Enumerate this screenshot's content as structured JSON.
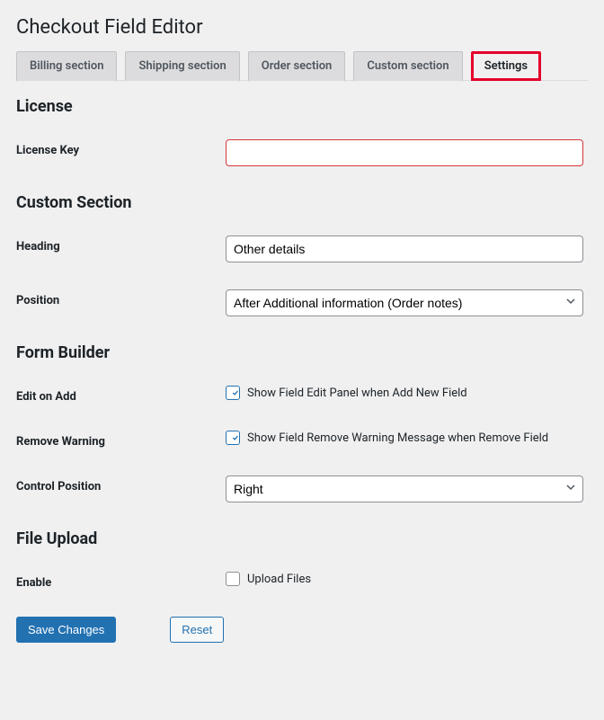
{
  "page_title": "Checkout Field Editor",
  "tabs": {
    "billing": "Billing section",
    "shipping": "Shipping section",
    "order": "Order section",
    "custom": "Custom section",
    "settings": "Settings"
  },
  "sections": {
    "license": {
      "heading": "License",
      "license_key_label": "License Key",
      "license_key_value": ""
    },
    "custom_section": {
      "heading": "Custom Section",
      "heading_label": "Heading",
      "heading_value": "Other details",
      "position_label": "Position",
      "position_value": "After Additional information (Order notes)"
    },
    "form_builder": {
      "heading": "Form Builder",
      "edit_on_add_label": "Edit on Add",
      "edit_on_add_text": "Show Field Edit Panel when Add New Field",
      "edit_on_add_checked": true,
      "remove_warning_label": "Remove Warning",
      "remove_warning_text": "Show Field Remove Warning Message when Remove Field",
      "remove_warning_checked": true,
      "control_position_label": "Control Position",
      "control_position_value": "Right"
    },
    "file_upload": {
      "heading": "File Upload",
      "enable_label": "Enable",
      "enable_text": "Upload Files",
      "enable_checked": false
    }
  },
  "buttons": {
    "save": "Save Changes",
    "reset": "Reset"
  }
}
